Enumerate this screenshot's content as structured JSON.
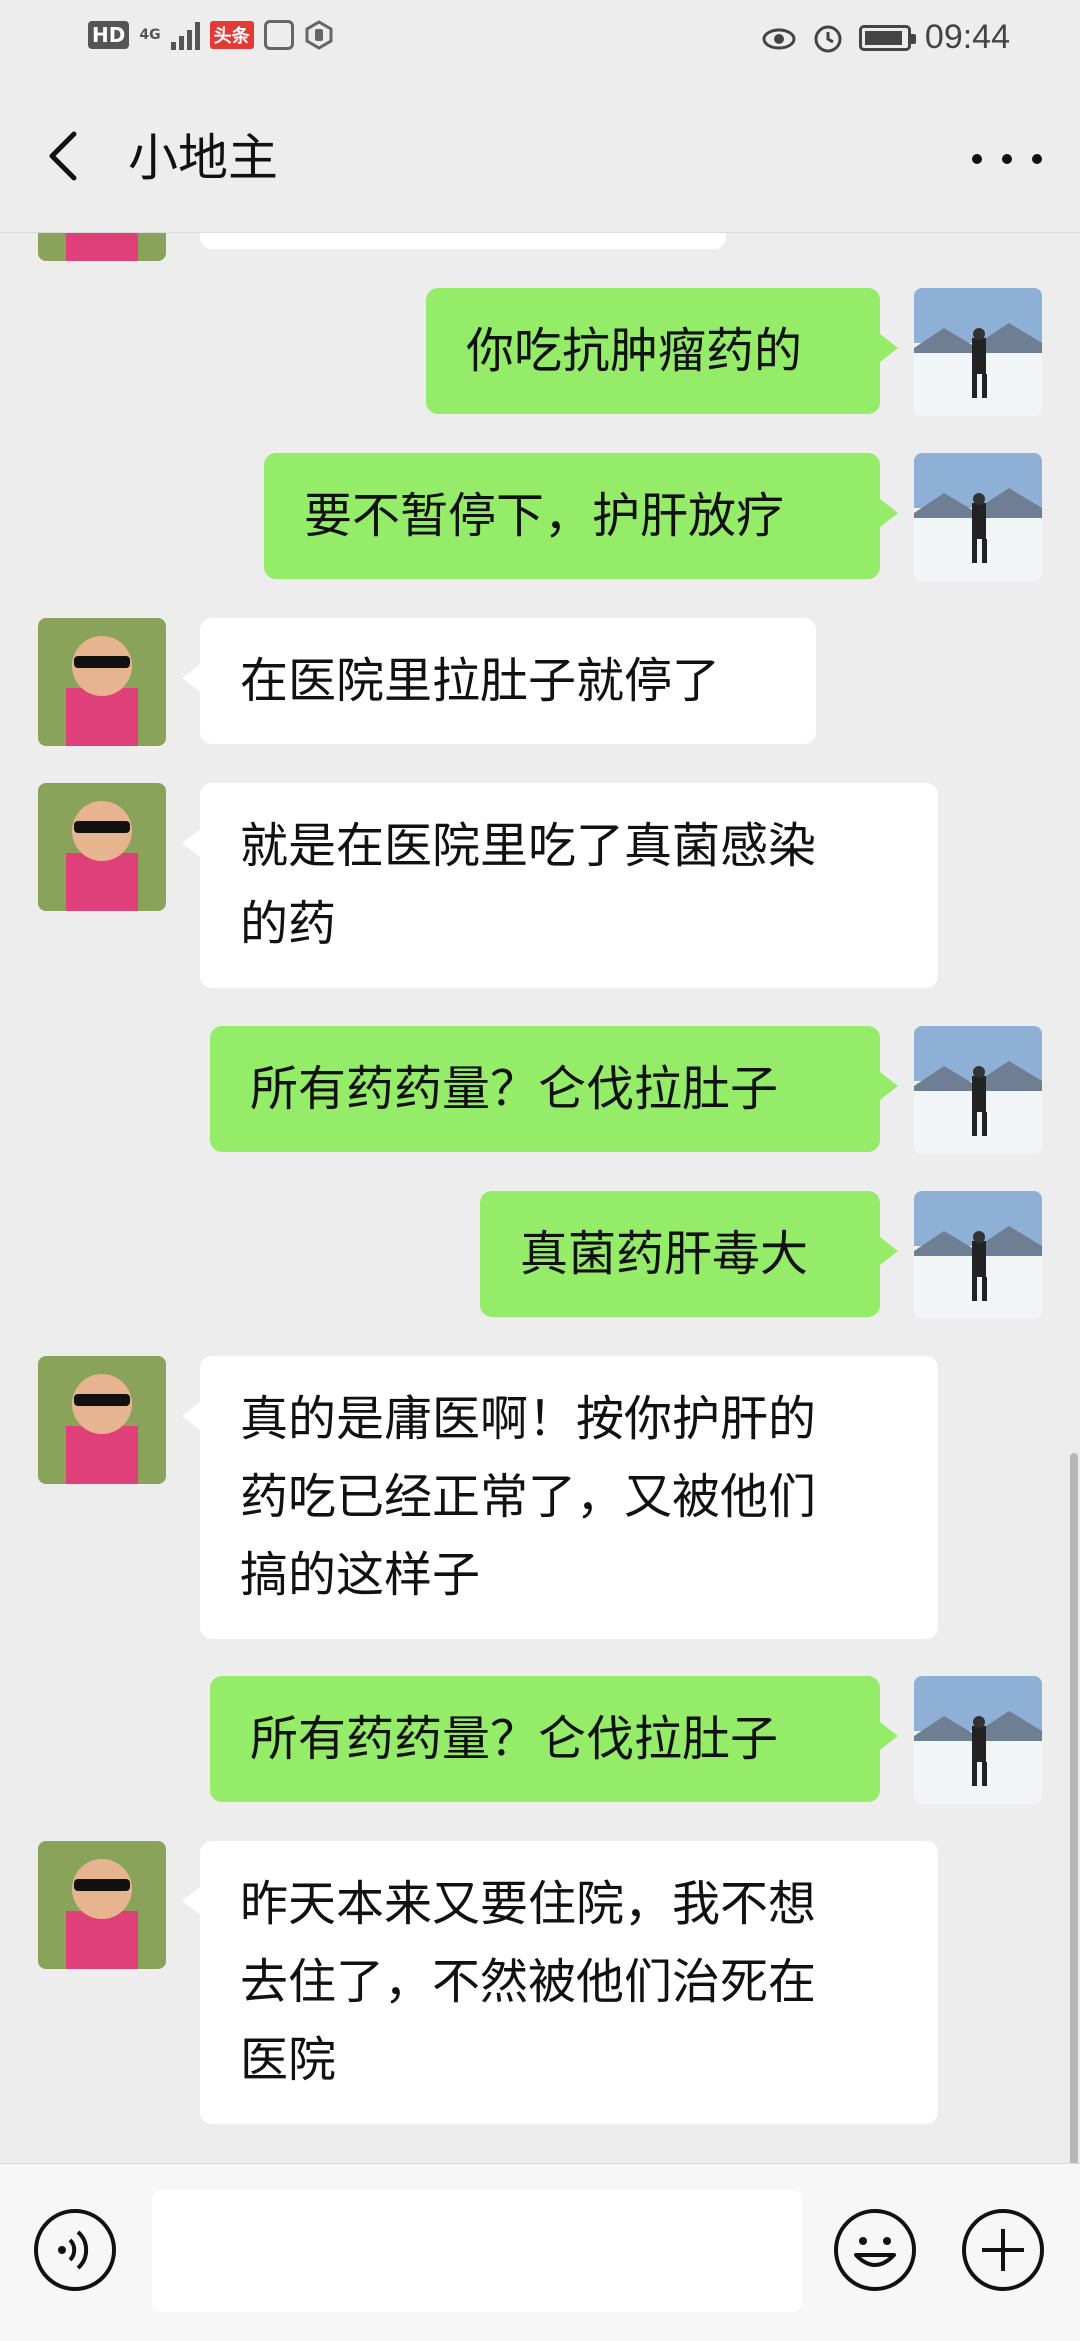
{
  "status_bar": {
    "hd_badge": "HD",
    "network_label": "4G",
    "toutiao_badge": "头条",
    "time": "09:44"
  },
  "header": {
    "title": "小地主"
  },
  "messages": [
    {
      "side": "in",
      "lines": [
        ""
      ]
    },
    {
      "side": "out",
      "lines": [
        "你吃抗肿瘤药的"
      ]
    },
    {
      "side": "out",
      "lines": [
        "要不暂停下，护肝放疗"
      ]
    },
    {
      "side": "in",
      "lines": [
        "在医院里拉肚子就停了"
      ]
    },
    {
      "side": "in",
      "lines": [
        "就是在医院里吃了真菌感染",
        "的药"
      ]
    },
    {
      "side": "out",
      "lines": [
        "所有药药量？仑伐拉肚子"
      ]
    },
    {
      "side": "out",
      "lines": [
        "真菌药肝毒大"
      ]
    },
    {
      "side": "in",
      "lines": [
        "真的是庸医啊！按你护肝的",
        "药吃已经正常了，又被他们",
        "搞的这样子"
      ]
    },
    {
      "side": "out",
      "lines": [
        "所有药药量？仑伐拉肚子"
      ]
    },
    {
      "side": "in",
      "lines": [
        "昨天本来又要住院，我不想",
        "去住了，不然被他们治死在",
        "医院"
      ]
    }
  ],
  "colors": {
    "outgoing_bubble": "#95ec69",
    "incoming_bubble": "#ffffff",
    "background": "#ededed"
  },
  "icons": {
    "back": "chevron-left-icon",
    "more": "more-dots-icon",
    "voice": "voice-icon",
    "emoji": "emoji-icon",
    "plus": "plus-icon"
  }
}
